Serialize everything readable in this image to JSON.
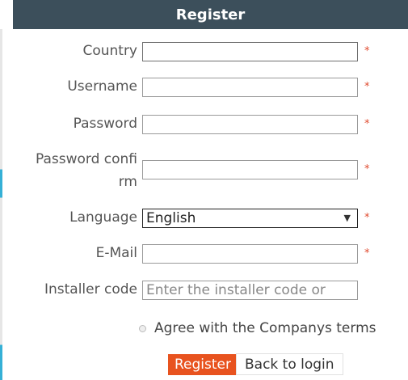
{
  "header": {
    "title": "Register"
  },
  "form": {
    "country": {
      "label": "Country",
      "value": "",
      "required_mark": "*"
    },
    "username": {
      "label": "Username",
      "value": "",
      "required_mark": "*"
    },
    "password": {
      "label": "Password",
      "value": "",
      "required_mark": "*"
    },
    "password_confirm": {
      "label_line1": "Password confi",
      "label_line2": "rm",
      "value": "",
      "required_mark": "*"
    },
    "language": {
      "label": "Language",
      "selected": "English",
      "required_mark": "*"
    },
    "email": {
      "label": "E-Mail",
      "value": "",
      "required_mark": "*"
    },
    "installer_code": {
      "label": "Installer code",
      "placeholder": "Enter the installer code or",
      "value": ""
    },
    "terms": {
      "label": "Agree with the Companys terms"
    }
  },
  "buttons": {
    "register_label": "Register",
    "back_label": "Back to login"
  },
  "colors": {
    "header_bg": "#3c4f5b",
    "required": "#e04a2f",
    "register_bg": "#e8531f"
  },
  "icons": {
    "select_arrow": "chevron-down-icon",
    "terms_radio": "radio-icon"
  }
}
